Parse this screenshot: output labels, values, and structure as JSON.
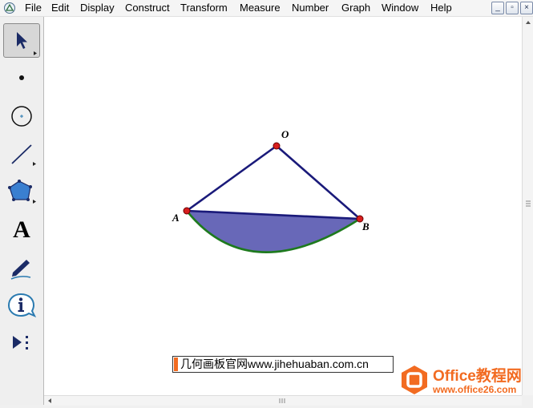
{
  "menubar": {
    "items": [
      "File",
      "Edit",
      "Display",
      "Construct",
      "Transform",
      "Measure",
      "Number",
      "Graph",
      "Window",
      "Help"
    ],
    "window_buttons": {
      "minimize": "_",
      "restore": "▫",
      "close": "×"
    }
  },
  "toolbox": {
    "tools": [
      "arrow-selection-tool",
      "point-tool",
      "compass-tool",
      "straightedge-tool",
      "polygon-tool",
      "text-tool",
      "marker-tool",
      "information-tool",
      "custom-tools"
    ],
    "text_tool_glyph": "A",
    "selected": "arrow-selection-tool"
  },
  "sketch": {
    "points": [
      {
        "label": "O"
      },
      {
        "label": "A"
      },
      {
        "label": "B"
      }
    ],
    "segment_color": "#1a1a7a",
    "arc_color": "#1e7a1e",
    "fill_color": "#6868b8",
    "point_color": "#d81e1e"
  },
  "caption": {
    "text": "几何画板官网www.jihehuaban.com.cn"
  },
  "watermark": {
    "title": "Office教程网",
    "url": "www.office26.com",
    "color": "#f26b21"
  }
}
